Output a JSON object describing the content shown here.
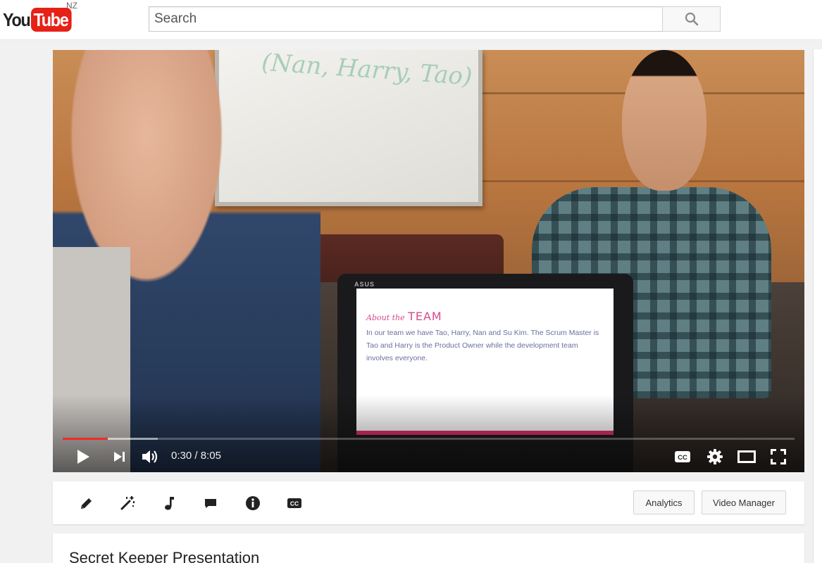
{
  "masthead": {
    "logo_you": "You",
    "logo_tube": "Tube",
    "country": "NZ",
    "search_placeholder": "Search",
    "search_icon": "search-icon"
  },
  "player": {
    "whiteboard_text": "(Nan, Harry, Tao)",
    "laptop_brand": "ASUS",
    "slide": {
      "heading_small": "About the",
      "heading_large": "TEAM",
      "body": "In our team we have Tao, Harry, Nan and Su Kim. The Scrum Master is Tao and Harry is the Product Owner while the development team involves everyone."
    },
    "current_time": "0:30",
    "time_separator": " / ",
    "duration": "8:05",
    "progress_fraction": 0.062,
    "loaded_fraction": 0.13,
    "icons": {
      "play": "play-icon",
      "next": "next-icon",
      "volume": "volume-icon",
      "captions": "captions-icon",
      "settings": "gear-icon",
      "theater": "theater-mode-icon",
      "fullscreen": "fullscreen-icon"
    }
  },
  "editor_bar": {
    "tools": [
      "pencil-icon",
      "magic-wand-icon",
      "music-note-icon",
      "comment-icon",
      "info-icon",
      "captions-icon"
    ],
    "analytics_label": "Analytics",
    "video_manager_label": "Video Manager"
  },
  "video": {
    "title": "Secret Keeper Presentation"
  },
  "colors": {
    "brand_red": "#e62117",
    "progress_red": "#f12b24",
    "page_bg": "#f1f1f1"
  }
}
